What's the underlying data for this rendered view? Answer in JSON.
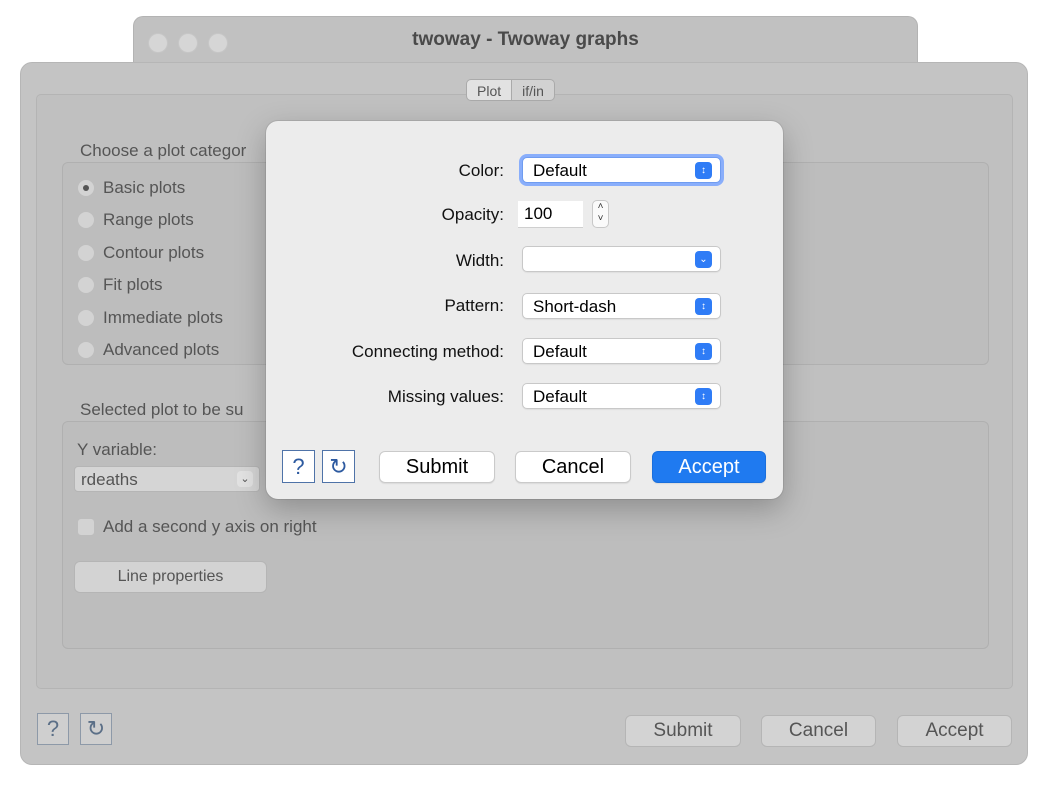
{
  "window": {
    "title": "twoway - Twoway graphs",
    "tabs": [
      "Plot",
      "if/in"
    ],
    "plot_category": {
      "label": "Choose a plot categor",
      "options": [
        "Basic plots",
        "Range plots",
        "Contour plots",
        "Fit plots",
        "Immediate plots",
        "Advanced plots"
      ],
      "selected": "Basic plots"
    },
    "selected_plot": {
      "label": "Selected plot to be su",
      "y_variable_label": "Y variable:",
      "y_variable_value": "rdeaths",
      "second_axis_label": "Add a second y axis on right",
      "line_properties_label": "Line properties"
    },
    "buttons": {
      "help": "?",
      "reset": "↻",
      "submit": "Submit",
      "cancel": "Cancel",
      "accept": "Accept"
    }
  },
  "dialog": {
    "color": {
      "label": "Color:",
      "value": "Default"
    },
    "opacity": {
      "label": "Opacity:",
      "value": "100"
    },
    "width": {
      "label": "Width:",
      "value": ""
    },
    "pattern": {
      "label": "Pattern:",
      "value": "Short-dash"
    },
    "connecting": {
      "label": "Connecting method:",
      "value": "Default"
    },
    "missing": {
      "label": "Missing values:",
      "value": "Default"
    },
    "buttons": {
      "help": "?",
      "reset": "↻",
      "submit": "Submit",
      "cancel": "Cancel",
      "accept": "Accept"
    }
  },
  "colors": {
    "accent": "#1f7af0",
    "focus_ring": "#89aefb"
  },
  "icons": {
    "help": "question-mark-icon",
    "reset": "reset-arrow-icon",
    "stepper": "up-down-chevron-icon"
  }
}
